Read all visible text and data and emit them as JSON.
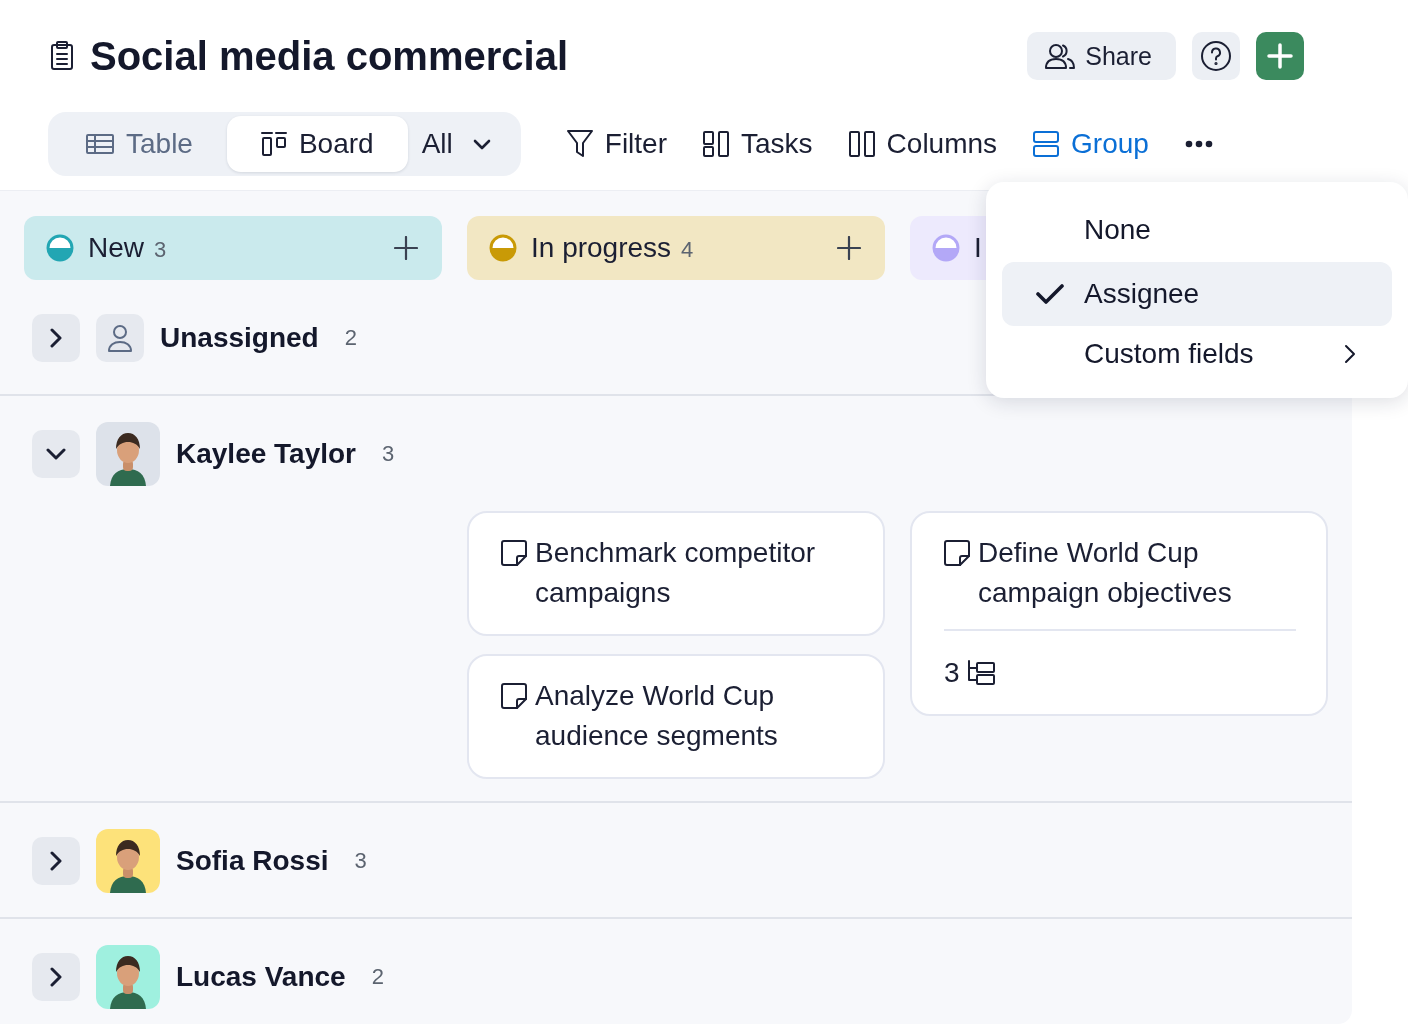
{
  "title": "Social media commercial",
  "header_buttons": [
    {
      "kind": "share",
      "label": "Share"
    },
    {
      "kind": "help"
    },
    {
      "kind": "add"
    }
  ],
  "view_tabs": [
    {
      "kind": "table",
      "label": "Table",
      "selected": false
    },
    {
      "kind": "board",
      "label": "Board",
      "selected": true
    }
  ],
  "view_filter": {
    "label": "All"
  },
  "toolbar": [
    {
      "kind": "filter",
      "label": "Filter",
      "active": false
    },
    {
      "kind": "tasks",
      "label": "Tasks",
      "active": false
    },
    {
      "kind": "columns",
      "label": "Columns",
      "active": false
    },
    {
      "kind": "group",
      "label": "Group",
      "active": true
    },
    {
      "kind": "more",
      "active": false
    }
  ],
  "columns": [
    {
      "title": "New",
      "count": "3",
      "color": "#22a6b3",
      "add_button": true
    },
    {
      "title": "In progress",
      "count": "4",
      "color": "#c99a06",
      "add_button": true
    },
    {
      "title": "I",
      "color": "#b3a8f7",
      "add_button": false
    }
  ],
  "groups": [
    {
      "kind": "unassigned",
      "name": "Unassigned",
      "count": "2",
      "expanded": false
    },
    {
      "kind": "person",
      "name": "Kaylee Taylor",
      "count": "3",
      "expanded": true,
      "color": "#dde2ea",
      "lanes": [
        {
          "cards": [
            {
              "title": "Benchmark competitor campaigns"
            },
            {
              "title": "Analyze World Cup audience segments"
            }
          ]
        },
        {
          "cards": [
            {
              "title": "Define World Cup campaign objectives",
              "subtasks": "3"
            }
          ]
        }
      ]
    },
    {
      "kind": "person",
      "name": "Sofia Rossi",
      "count": "3",
      "expanded": false,
      "color": "#fde27a"
    },
    {
      "kind": "person",
      "name": "Lucas Vance",
      "count": "2",
      "expanded": false,
      "color": "#9ff0df"
    }
  ],
  "group_menu": {
    "items": [
      {
        "label": "None",
        "selected": false
      },
      {
        "label": "Assignee",
        "selected": true
      },
      {
        "label": "Custom fields",
        "selected": false,
        "submenu": true
      }
    ]
  }
}
